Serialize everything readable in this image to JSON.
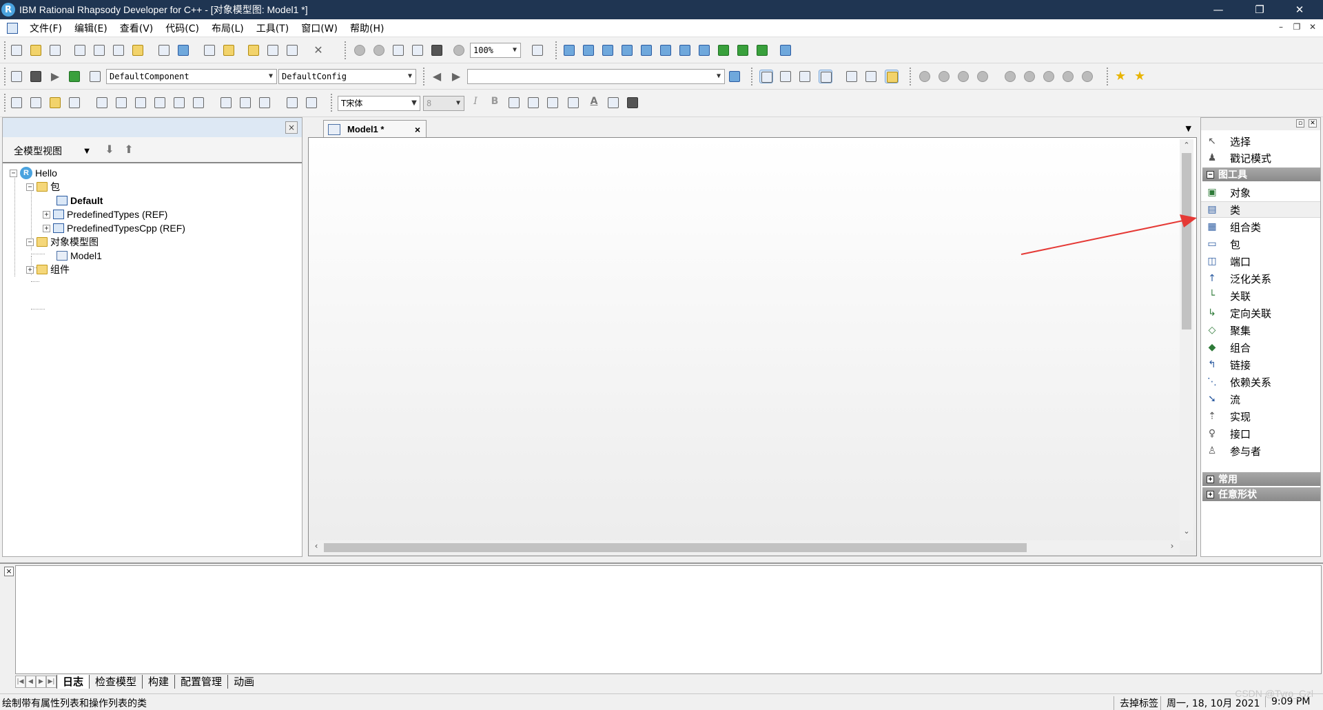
{
  "window": {
    "title": "IBM Rational Rhapsody Developer for C++ - [对象模型图: Model1 *]",
    "app_icon_letter": "R",
    "minimize": "—",
    "restore": "❐",
    "close": "✕"
  },
  "menu": {
    "items": [
      "文件(F)",
      "编辑(E)",
      "查看(V)",
      "代码(C)",
      "布局(L)",
      "工具(T)",
      "窗口(W)",
      "帮助(H)"
    ],
    "mdi_minimize": "–",
    "mdi_restore": "❐",
    "mdi_close": "✕"
  },
  "toolbar1": {
    "zoom_value": "100%"
  },
  "toolbar2": {
    "component_value": "DefaultComponent",
    "config_value": "DefaultConfig",
    "search_value": ""
  },
  "toolbar3": {
    "font_value": "宋体",
    "font_prefix": "T",
    "size_value": "8",
    "italic": "I",
    "bold": "B",
    "font_color": "A"
  },
  "browser": {
    "close": "×",
    "view_label": "全模型视图",
    "tree": {
      "root": "Hello",
      "packages": "包",
      "default_pkg": "Default",
      "predef": "PredefinedTypes (REF)",
      "predef_cpp": "PredefinedTypesCpp (REF)",
      "omd_folder": "对象模型图",
      "model1": "Model1",
      "components": "组件"
    }
  },
  "diagram": {
    "tab_label": "Model1 *",
    "tab_close": "×"
  },
  "palette": {
    "top_items": [
      "选择",
      "戳记模式"
    ],
    "section_tools": "图工具",
    "tools": [
      "对象",
      "类",
      "组合类",
      "包",
      "端口",
      "泛化关系",
      "关联",
      "定向关联",
      "聚集",
      "组合",
      "链接",
      "依赖关系",
      "流",
      "实现",
      "接口",
      "参与者"
    ],
    "section_common": "常用",
    "section_free": "任意形状"
  },
  "output": {
    "close": "×",
    "tabs": [
      "日志",
      "检查模型",
      "构建",
      "配置管理",
      "动画"
    ]
  },
  "status": {
    "message": "绘制带有属性列表和操作列表的类",
    "mode": "去掉标签",
    "datetime": "周一, 18, 10月 2021",
    "time": "9:09  PM",
    "watermark": "CSDN @Tyro_Gzl"
  },
  "colors": {
    "titlebar": "#1f3552",
    "arrow": "#e53935"
  }
}
